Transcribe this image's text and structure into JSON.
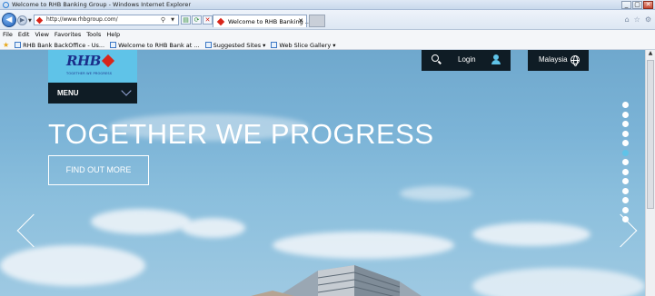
{
  "window": {
    "title": "Welcome to RHB Banking Group - Windows Internet Explorer",
    "controls": [
      "_",
      "▢",
      "✕"
    ]
  },
  "address": {
    "url": "http://www.rhbgroup.com/"
  },
  "tab": {
    "label": "Welcome to RHB Banking ...",
    "close": "✕"
  },
  "menubar": {
    "items": [
      "File",
      "Edit",
      "View",
      "Favorites",
      "Tools",
      "Help"
    ]
  },
  "favorites": {
    "items": [
      "RHB Bank BackOffice - Us...",
      "Welcome to RHB Bank at ...",
      "Suggested Sites ▾",
      "Web Slice Gallery ▾"
    ]
  },
  "site": {
    "logo": {
      "brand": "RHB",
      "tagline": "TOGETHER WE PROGRESS",
      "brand_red": "#d8251a",
      "brand_blue": "#1b2f8a",
      "box_color": "#5fc3e8"
    },
    "menu_label": "MENU",
    "login_label": "Login",
    "country_label": "Malaysia",
    "hero": {
      "headline": "TOGETHER WE PROGRESS",
      "cta": "FIND OUT MORE"
    },
    "carousel": {
      "slide_count": 13,
      "active_index": 5
    }
  },
  "icons": {
    "back": "back-arrow-icon",
    "forward": "forward-arrow-icon",
    "search": "search-icon",
    "user": "user-icon",
    "globe": "globe-icon",
    "prev": "chevron-left-icon",
    "next": "chevron-right-icon"
  }
}
